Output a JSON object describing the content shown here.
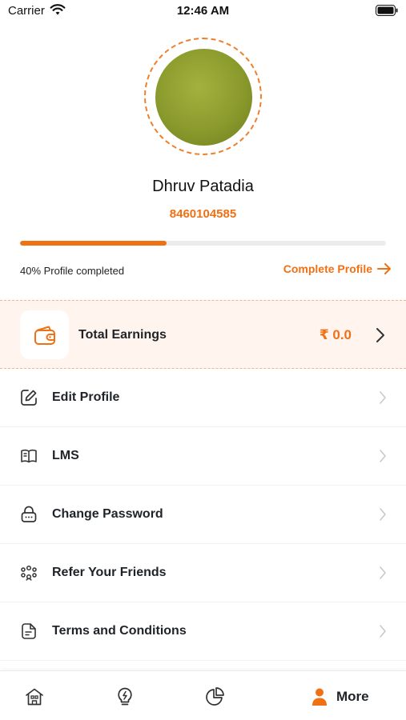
{
  "status_bar": {
    "carrier": "Carrier",
    "time": "12:46 AM"
  },
  "profile": {
    "name": "Dhruv Patadia",
    "phone": "8460104585",
    "completion_percent": 40,
    "completion_text": "40% Profile completed",
    "complete_profile_label": "Complete Profile"
  },
  "earnings": {
    "label": "Total Earnings",
    "value": "₹ 0.0"
  },
  "menu": {
    "items": [
      {
        "label": "Edit Profile",
        "icon": "edit-icon"
      },
      {
        "label": "LMS",
        "icon": "book-icon"
      },
      {
        "label": "Change Password",
        "icon": "lock-icon"
      },
      {
        "label": "Refer Your Friends",
        "icon": "people-icon"
      },
      {
        "label": "Terms and Conditions",
        "icon": "document-icon"
      }
    ]
  },
  "bottom_nav": {
    "items": [
      {
        "icon": "home-icon"
      },
      {
        "icon": "bulb-icon"
      },
      {
        "icon": "pie-chart-icon"
      },
      {
        "icon": "user-icon",
        "label": "More",
        "active": true
      }
    ]
  },
  "colors": {
    "accent": "#f07014",
    "earnings_bg": "#fff4ee",
    "text": "#1f2328"
  }
}
